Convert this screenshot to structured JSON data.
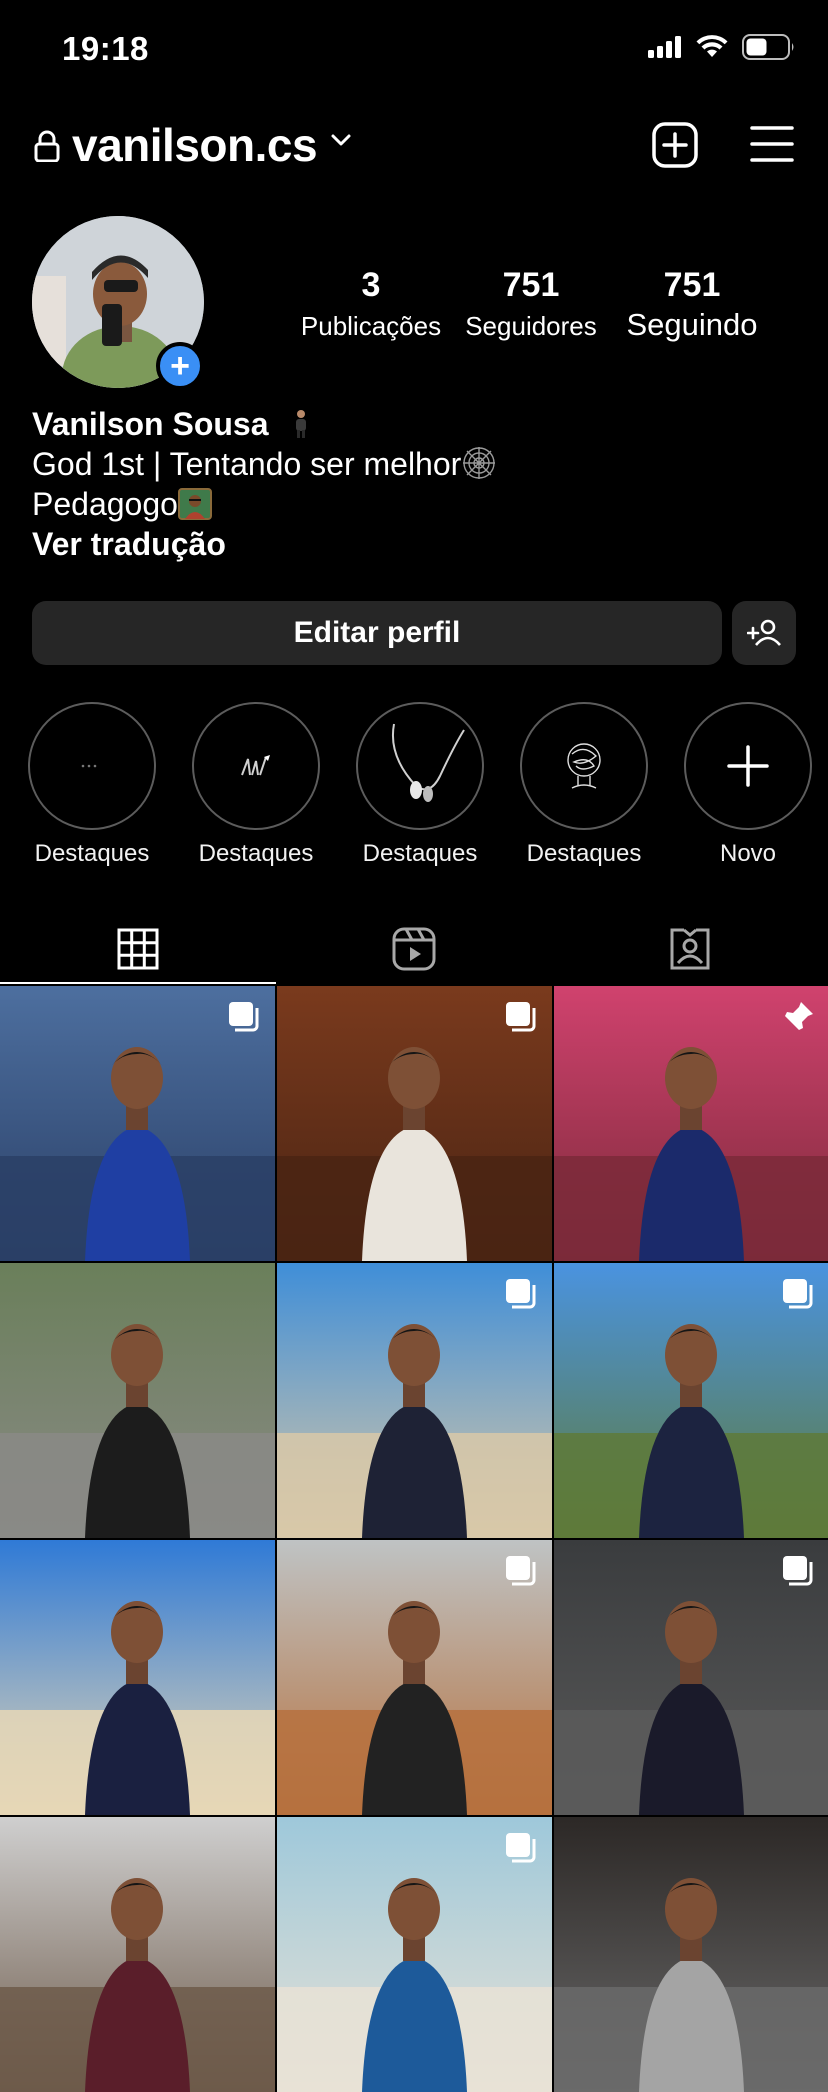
{
  "status_bar": {
    "time": "19:18"
  },
  "header": {
    "username": "vanilson.cs"
  },
  "profile": {
    "stats": [
      {
        "value": "3",
        "label": "Publicações"
      },
      {
        "value": "751",
        "label": "Seguidores"
      },
      {
        "value": "751",
        "label": "Seguindo"
      }
    ],
    "name": "Vanilson Sousa",
    "bio_line1": "God 1st | Tentando ser melhor",
    "bio_line2": "Pedagogo",
    "translate_link": "Ver tradução"
  },
  "actions": {
    "edit_label": "Editar perfil"
  },
  "highlights": [
    {
      "label": "Destaques",
      "icon": "dots-icon"
    },
    {
      "label": "Destaques",
      "icon": "drawing-icon"
    },
    {
      "label": "Destaques",
      "icon": "earphones-icon"
    },
    {
      "label": "Destaques",
      "icon": "head-scribble-icon"
    },
    {
      "label": "Novo",
      "icon": "plus-icon"
    }
  ],
  "tabs": [
    {
      "name": "grid",
      "icon": "grid-icon",
      "active": true
    },
    {
      "name": "reels",
      "icon": "reels-icon",
      "active": false
    },
    {
      "name": "tagged",
      "icon": "tagged-icon",
      "active": false
    }
  ],
  "posts": [
    {
      "badge": "carousel-icon",
      "sky": "#4d6f9f",
      "ground": "#2a3f66",
      "shirt": "#1f3fa3"
    },
    {
      "badge": "carousel-icon",
      "sky": "#7a3a1d",
      "ground": "#4a2413",
      "shirt": "#e9e4dc"
    },
    {
      "badge": "pin-icon",
      "sky": "#d0426e",
      "ground": "#7b2a3a",
      "shirt": "#1b2a6b"
    },
    {
      "badge": "",
      "sky": "#6a7f5a",
      "ground": "#8a8a86",
      "shirt": "#1c1c1c"
    },
    {
      "badge": "carousel-icon",
      "sky": "#3f8ed8",
      "ground": "#d8c8a8",
      "shirt": "#1e2235"
    },
    {
      "badge": "carousel-icon",
      "sky": "#4a93e0",
      "ground": "#5e7a3a",
      "shirt": "#1c2340"
    },
    {
      "badge": "",
      "sky": "#2f7ad6",
      "ground": "#e6d7b6",
      "shirt": "#1a2040"
    },
    {
      "badge": "carousel-icon",
      "sky": "#bfc3c4",
      "ground": "#b6713e",
      "shirt": "#222222"
    },
    {
      "badge": "carousel-icon",
      "sky": "#3a3c3e",
      "ground": "#5a5a5a",
      "shirt": "#1a1a2a"
    },
    {
      "badge": "",
      "sky": "#cfcfcf",
      "ground": "#6d5a4a",
      "shirt": "#5a1e2a"
    },
    {
      "badge": "carousel-icon",
      "sky": "#9ec8da",
      "ground": "#e8e2d6",
      "shirt": "#1d5a9a"
    },
    {
      "badge": "",
      "sky": "#2c2826",
      "ground": "#6a6a6a",
      "shirt": "#a4a4a4"
    }
  ],
  "colors": {
    "accent": "#3a8ff5",
    "button_bg": "#262626",
    "background": "#000000"
  }
}
